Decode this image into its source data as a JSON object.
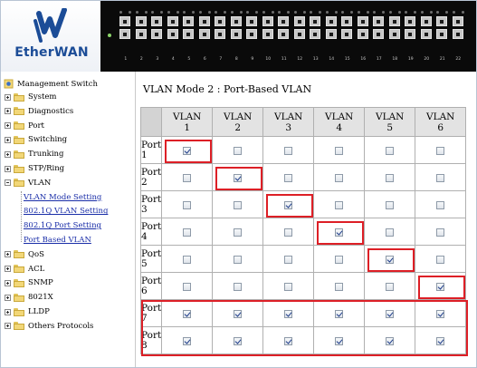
{
  "brand": {
    "logo_text": "EtherWAN",
    "accent": "#1b4c97"
  },
  "device": {
    "port_numbers": [
      "1",
      "2",
      "3",
      "4",
      "5",
      "6",
      "7",
      "8",
      "9",
      "10",
      "11",
      "12",
      "13",
      "14",
      "15",
      "16",
      "17",
      "18",
      "19",
      "20",
      "21",
      "22"
    ]
  },
  "sidebar": {
    "root": "Management Switch",
    "items": [
      {
        "label": "System"
      },
      {
        "label": "Diagnostics"
      },
      {
        "label": "Port"
      },
      {
        "label": "Switching"
      },
      {
        "label": "Trunking"
      },
      {
        "label": "STP/Ring"
      },
      {
        "label": "VLAN",
        "expanded": true
      },
      {
        "label": "QoS"
      },
      {
        "label": "ACL"
      },
      {
        "label": "SNMP"
      },
      {
        "label": "8021X"
      },
      {
        "label": "LLDP"
      },
      {
        "label": "Others Protocols"
      }
    ],
    "vlan_children": [
      "VLAN Mode Setting",
      "802.1Q VLAN Setting",
      "802.1Q Port Setting",
      "Port Based VLAN"
    ]
  },
  "main": {
    "title": "VLAN Mode 2 : Port-Based VLAN",
    "vlan_word": "VLAN",
    "port_word": "Port",
    "vlans": [
      "1",
      "2",
      "3",
      "4",
      "5",
      "6"
    ],
    "rows": [
      {
        "port": "1",
        "checked": [
          true,
          false,
          false,
          false,
          false,
          false
        ]
      },
      {
        "port": "2",
        "checked": [
          false,
          true,
          false,
          false,
          false,
          false
        ]
      },
      {
        "port": "3",
        "checked": [
          false,
          false,
          true,
          false,
          false,
          false
        ]
      },
      {
        "port": "4",
        "checked": [
          false,
          false,
          false,
          true,
          false,
          false
        ]
      },
      {
        "port": "5",
        "checked": [
          false,
          false,
          false,
          false,
          true,
          false
        ]
      },
      {
        "port": "6",
        "checked": [
          false,
          false,
          false,
          false,
          false,
          true
        ]
      },
      {
        "port": "7",
        "checked": [
          true,
          true,
          true,
          true,
          true,
          true
        ]
      },
      {
        "port": "8",
        "checked": [
          true,
          true,
          true,
          true,
          true,
          true
        ]
      }
    ],
    "highlight_color": "#dd1f26"
  }
}
